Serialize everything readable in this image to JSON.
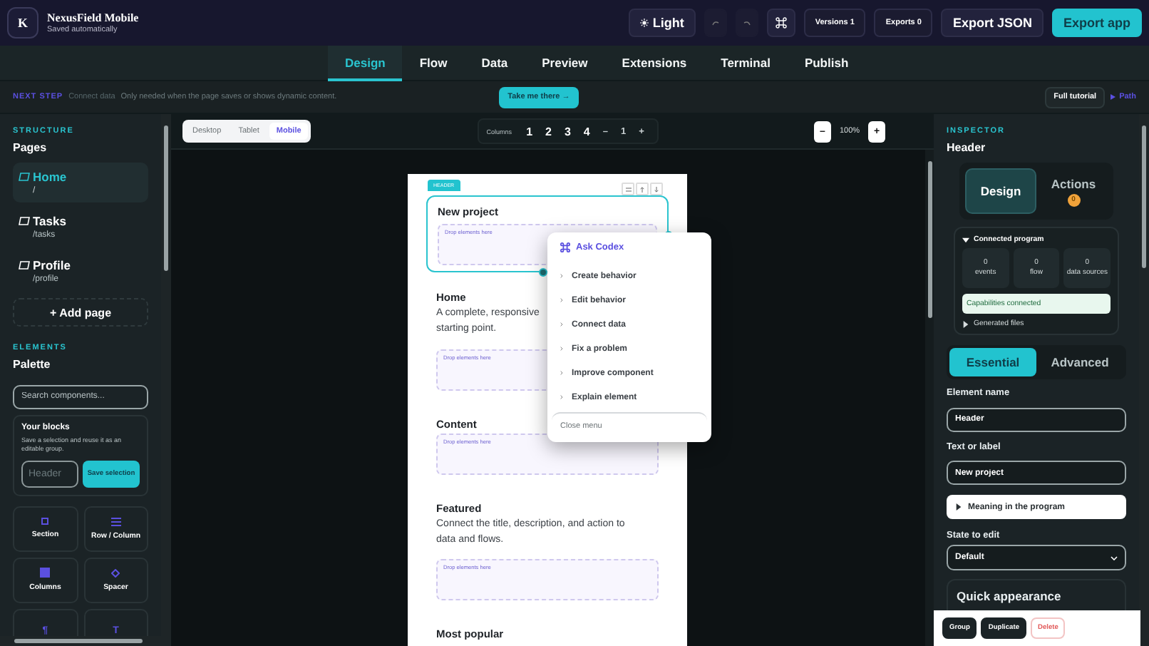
{
  "app": {
    "logo": "K",
    "title": "NexusField Mobile",
    "subtitle": "Saved automatically"
  },
  "toolbar": {
    "theme": "Light",
    "versions": "Versions 1",
    "exports": "Exports 0",
    "export_json": "Export JSON",
    "export_app": "Export app"
  },
  "tabs": [
    {
      "label": "Design",
      "selected": true
    },
    {
      "label": "Flow",
      "selected": false
    },
    {
      "label": "Data",
      "selected": false
    },
    {
      "label": "Preview",
      "selected": false
    },
    {
      "label": "Extensions",
      "selected": false
    },
    {
      "label": "Terminal",
      "selected": false
    },
    {
      "label": "Publish",
      "selected": false
    }
  ],
  "next_step": {
    "label": "NEXT STEP",
    "step": "Connect data",
    "hint": "Only needed when the page saves or shows dynamic content.",
    "action": "Take me there →",
    "tutorial": "Full tutorial",
    "path": "Path"
  },
  "structure": {
    "label": "STRUCTURE",
    "title": "Pages",
    "pages": [
      {
        "name": "Home",
        "route": "/",
        "selected": true
      },
      {
        "name": "Tasks",
        "route": "/tasks",
        "selected": false
      },
      {
        "name": "Profile",
        "route": "/profile",
        "selected": false
      }
    ],
    "add": "+ Add page"
  },
  "elements": {
    "label": "ELEMENTS",
    "title": "Palette",
    "search": {
      "placeholder": "Search components..."
    },
    "blocks": {
      "title": "Your blocks",
      "text": "Save a selection and reuse it as an editable group.",
      "placeholder": "Header",
      "button": "Save selection"
    },
    "palette": [
      {
        "kind": "section",
        "label": "Section"
      },
      {
        "kind": "rows",
        "label": "Row / Column"
      },
      {
        "kind": "columns",
        "label": "Columns"
      },
      {
        "kind": "spacer",
        "label": "Spacer"
      },
      {
        "kind": "glyph",
        "glyph": "¶"
      },
      {
        "kind": "glyph",
        "glyph": "T"
      }
    ]
  },
  "canvas": {
    "devices": [
      {
        "label": "Desktop",
        "selected": false
      },
      {
        "label": "Tablet",
        "selected": false
      },
      {
        "label": "Mobile",
        "selected": true
      }
    ],
    "columns": {
      "label": "Columns",
      "options": [
        "1",
        "2",
        "3",
        "4"
      ],
      "minus": "–",
      "value": "1",
      "plus": "+"
    },
    "zoom": {
      "minus": "–",
      "value": "100%",
      "plus": "+"
    }
  },
  "page": {
    "header": {
      "badge": "HEADER",
      "title": "New project",
      "drop": "Drop elements here"
    },
    "sections": [
      {
        "title": "Home",
        "lines": [
          "A complete, responsive",
          "starting point."
        ],
        "drop": "Drop elements here"
      },
      {
        "title": "Content",
        "drop": "Drop elements here"
      },
      {
        "title": "Featured",
        "lines": [
          "Connect the title, description, and action to",
          "data and flows."
        ],
        "drop": "Drop elements here"
      },
      {
        "title": "Most popular"
      }
    ]
  },
  "context_menu": {
    "title": "Ask Codex",
    "items": [
      "Create behavior",
      "Edit behavior",
      "Connect data",
      "Fix a problem",
      "Improve component",
      "Explain element"
    ],
    "close": "Close menu"
  },
  "inspector": {
    "label": "INSPECTOR",
    "title": "Header",
    "tabs": [
      {
        "label": "Design",
        "selected": true
      },
      {
        "label": "Actions",
        "selected": false,
        "badge": "0"
      }
    ],
    "connected": {
      "title": "Connected program",
      "expanded": true,
      "stats": [
        {
          "value": "0",
          "label": "events"
        },
        {
          "value": "0",
          "label": "flow"
        },
        {
          "value": "0",
          "label": "data sources"
        }
      ],
      "status": "Capabilities connected",
      "generated": "Generated files",
      "generated_expanded": false
    },
    "modes": [
      {
        "label": "Essential",
        "selected": true
      },
      {
        "label": "Advanced",
        "selected": false
      }
    ],
    "element_name": {
      "label": "Element name",
      "value": "Header"
    },
    "text_label": {
      "label": "Text or label",
      "value": "New project"
    },
    "meaning": "Meaning in the program",
    "state": {
      "label": "State to edit",
      "value": "Default"
    },
    "quick": "Quick appearance"
  },
  "actions": [
    {
      "label": "Group",
      "kind": "dark"
    },
    {
      "label": "Duplicate",
      "kind": "dark"
    },
    {
      "label": "Delete",
      "kind": "danger"
    }
  ]
}
